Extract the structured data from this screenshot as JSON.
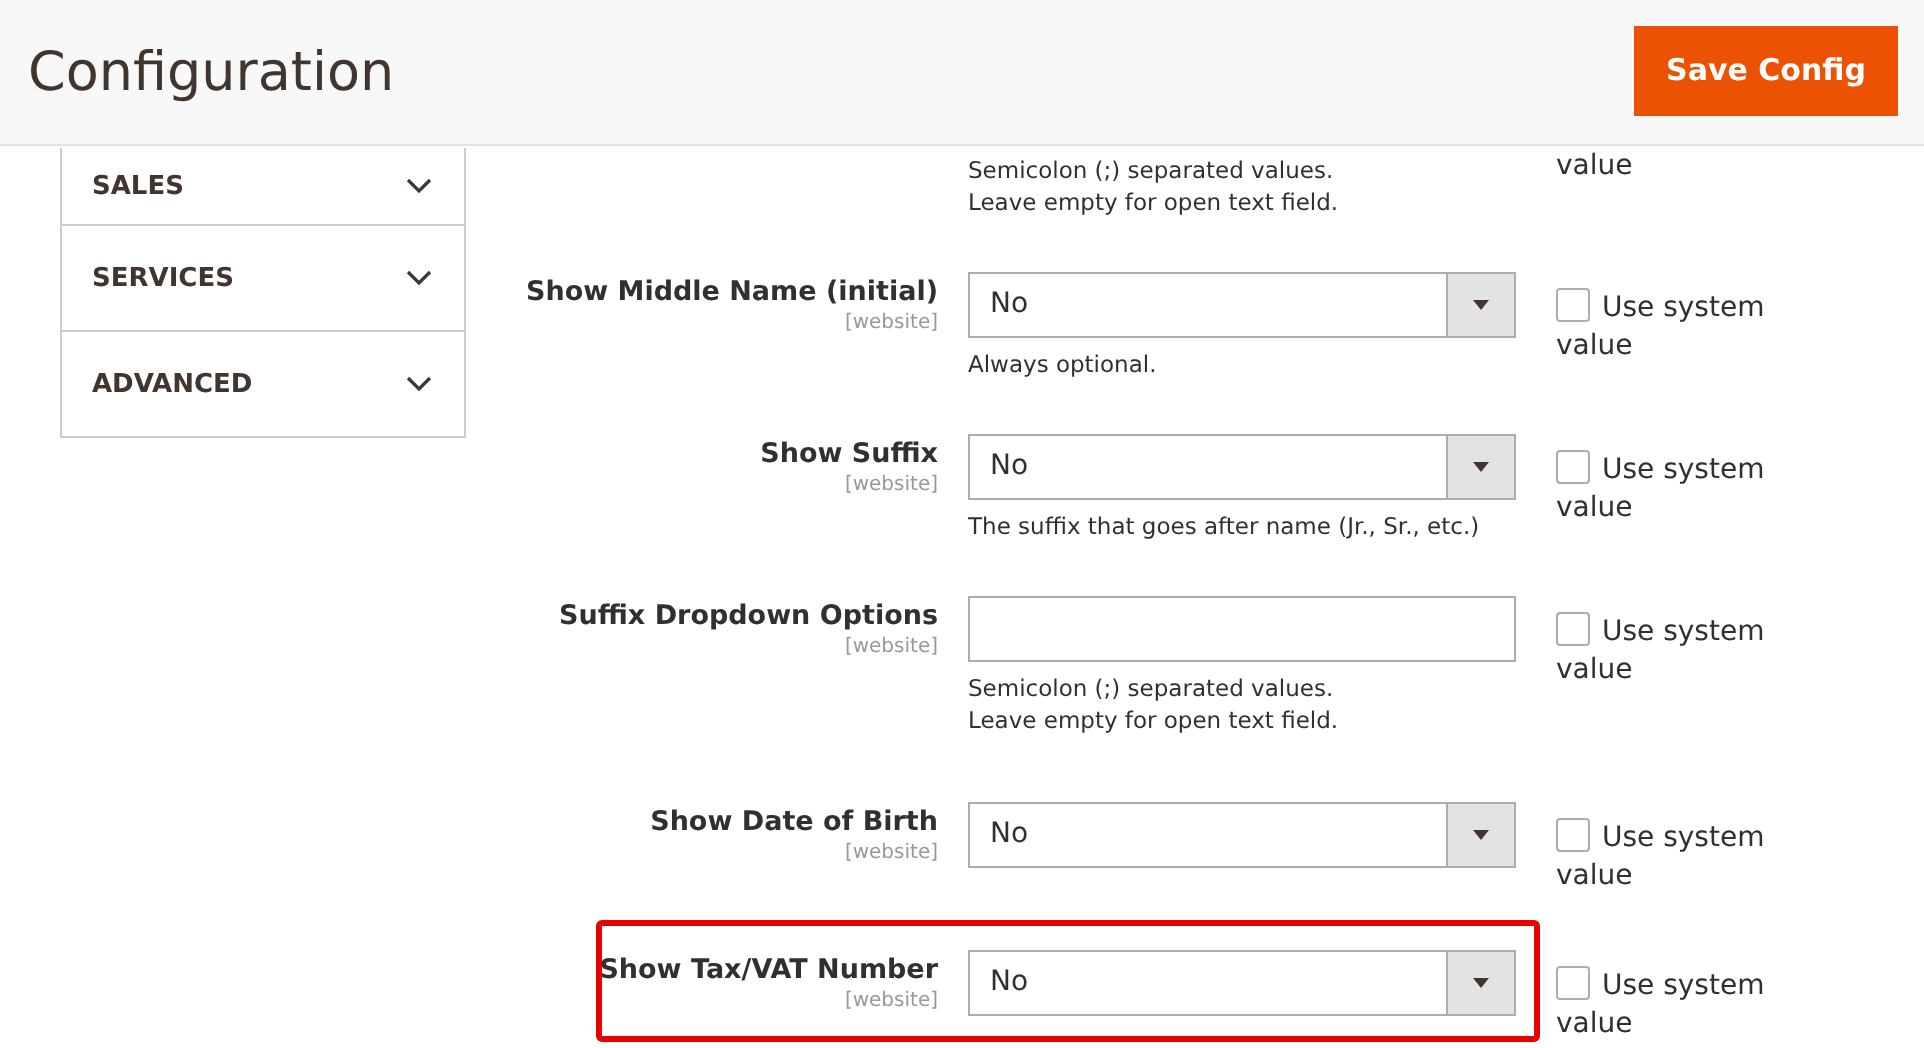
{
  "header": {
    "title": "Configuration",
    "save_button": "Save Config"
  },
  "sidebar": {
    "items": [
      {
        "label": "SALES",
        "expanded": false
      },
      {
        "label": "SERVICES",
        "expanded": false
      },
      {
        "label": "ADVANCED",
        "expanded": false
      }
    ]
  },
  "partial_row": {
    "note": [
      "Semicolon (;) separated values.",
      "Leave empty for open text field."
    ],
    "use_system_tail": "value"
  },
  "rows": [
    {
      "kind": "select",
      "label": "Show Middle Name (initial)",
      "scope": "[website]",
      "value": "No",
      "note": [
        "Always optional."
      ],
      "use_system": "Use system value",
      "use_system_checked": false,
      "highlighted": false
    },
    {
      "kind": "select",
      "label": "Show Suffix",
      "scope": "[website]",
      "value": "No",
      "note": [
        "The suffix that goes after name (Jr., Sr., etc.)"
      ],
      "use_system": "Use system value",
      "use_system_checked": false,
      "highlighted": false
    },
    {
      "kind": "text",
      "label": "Suffix Dropdown Options",
      "scope": "[website]",
      "note": [
        "Semicolon (;) separated values.",
        "Leave empty for open text field."
      ],
      "use_system": "Use system value",
      "use_system_checked": false,
      "highlighted": false
    },
    {
      "kind": "select",
      "label": "Show Date of Birth",
      "scope": "[website]",
      "value": "No",
      "use_system": "Use system value",
      "use_system_checked": false,
      "highlighted": false
    },
    {
      "kind": "select",
      "label": "Show Tax/VAT Number",
      "scope": "[website]",
      "value": "No",
      "use_system": "Use system value",
      "use_system_checked": false,
      "highlighted": true
    }
  ]
}
